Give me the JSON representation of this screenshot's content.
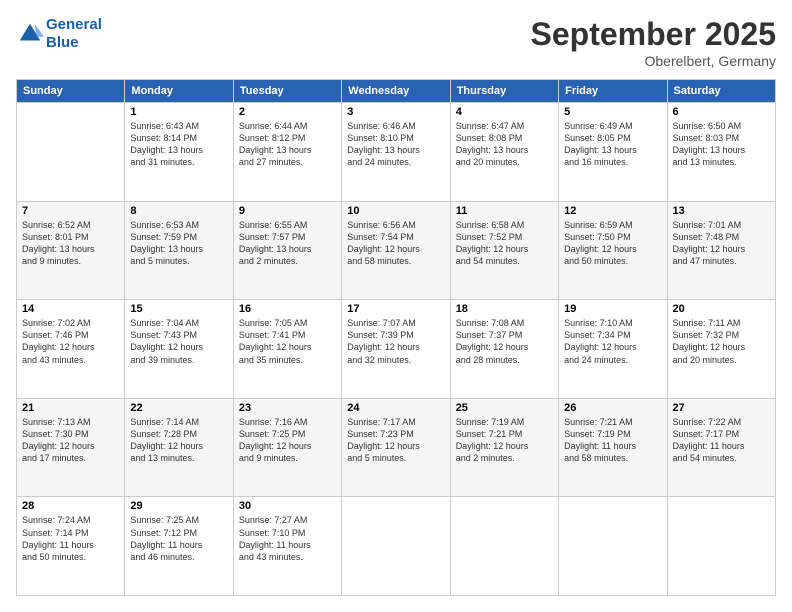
{
  "header": {
    "logo_line1": "General",
    "logo_line2": "Blue",
    "month": "September 2025",
    "location": "Oberelbert, Germany"
  },
  "days_of_week": [
    "Sunday",
    "Monday",
    "Tuesday",
    "Wednesday",
    "Thursday",
    "Friday",
    "Saturday"
  ],
  "weeks": [
    [
      {
        "day": "",
        "info": ""
      },
      {
        "day": "1",
        "info": "Sunrise: 6:43 AM\nSunset: 8:14 PM\nDaylight: 13 hours\nand 31 minutes."
      },
      {
        "day": "2",
        "info": "Sunrise: 6:44 AM\nSunset: 8:12 PM\nDaylight: 13 hours\nand 27 minutes."
      },
      {
        "day": "3",
        "info": "Sunrise: 6:46 AM\nSunset: 8:10 PM\nDaylight: 13 hours\nand 24 minutes."
      },
      {
        "day": "4",
        "info": "Sunrise: 6:47 AM\nSunset: 8:08 PM\nDaylight: 13 hours\nand 20 minutes."
      },
      {
        "day": "5",
        "info": "Sunrise: 6:49 AM\nSunset: 8:05 PM\nDaylight: 13 hours\nand 16 minutes."
      },
      {
        "day": "6",
        "info": "Sunrise: 6:50 AM\nSunset: 8:03 PM\nDaylight: 13 hours\nand 13 minutes."
      }
    ],
    [
      {
        "day": "7",
        "info": "Sunrise: 6:52 AM\nSunset: 8:01 PM\nDaylight: 13 hours\nand 9 minutes."
      },
      {
        "day": "8",
        "info": "Sunrise: 6:53 AM\nSunset: 7:59 PM\nDaylight: 13 hours\nand 5 minutes."
      },
      {
        "day": "9",
        "info": "Sunrise: 6:55 AM\nSunset: 7:57 PM\nDaylight: 13 hours\nand 2 minutes."
      },
      {
        "day": "10",
        "info": "Sunrise: 6:56 AM\nSunset: 7:54 PM\nDaylight: 12 hours\nand 58 minutes."
      },
      {
        "day": "11",
        "info": "Sunrise: 6:58 AM\nSunset: 7:52 PM\nDaylight: 12 hours\nand 54 minutes."
      },
      {
        "day": "12",
        "info": "Sunrise: 6:59 AM\nSunset: 7:50 PM\nDaylight: 12 hours\nand 50 minutes."
      },
      {
        "day": "13",
        "info": "Sunrise: 7:01 AM\nSunset: 7:48 PM\nDaylight: 12 hours\nand 47 minutes."
      }
    ],
    [
      {
        "day": "14",
        "info": "Sunrise: 7:02 AM\nSunset: 7:46 PM\nDaylight: 12 hours\nand 43 minutes."
      },
      {
        "day": "15",
        "info": "Sunrise: 7:04 AM\nSunset: 7:43 PM\nDaylight: 12 hours\nand 39 minutes."
      },
      {
        "day": "16",
        "info": "Sunrise: 7:05 AM\nSunset: 7:41 PM\nDaylight: 12 hours\nand 35 minutes."
      },
      {
        "day": "17",
        "info": "Sunrise: 7:07 AM\nSunset: 7:39 PM\nDaylight: 12 hours\nand 32 minutes."
      },
      {
        "day": "18",
        "info": "Sunrise: 7:08 AM\nSunset: 7:37 PM\nDaylight: 12 hours\nand 28 minutes."
      },
      {
        "day": "19",
        "info": "Sunrise: 7:10 AM\nSunset: 7:34 PM\nDaylight: 12 hours\nand 24 minutes."
      },
      {
        "day": "20",
        "info": "Sunrise: 7:11 AM\nSunset: 7:32 PM\nDaylight: 12 hours\nand 20 minutes."
      }
    ],
    [
      {
        "day": "21",
        "info": "Sunrise: 7:13 AM\nSunset: 7:30 PM\nDaylight: 12 hours\nand 17 minutes."
      },
      {
        "day": "22",
        "info": "Sunrise: 7:14 AM\nSunset: 7:28 PM\nDaylight: 12 hours\nand 13 minutes."
      },
      {
        "day": "23",
        "info": "Sunrise: 7:16 AM\nSunset: 7:25 PM\nDaylight: 12 hours\nand 9 minutes."
      },
      {
        "day": "24",
        "info": "Sunrise: 7:17 AM\nSunset: 7:23 PM\nDaylight: 12 hours\nand 5 minutes."
      },
      {
        "day": "25",
        "info": "Sunrise: 7:19 AM\nSunset: 7:21 PM\nDaylight: 12 hours\nand 2 minutes."
      },
      {
        "day": "26",
        "info": "Sunrise: 7:21 AM\nSunset: 7:19 PM\nDaylight: 11 hours\nand 58 minutes."
      },
      {
        "day": "27",
        "info": "Sunrise: 7:22 AM\nSunset: 7:17 PM\nDaylight: 11 hours\nand 54 minutes."
      }
    ],
    [
      {
        "day": "28",
        "info": "Sunrise: 7:24 AM\nSunset: 7:14 PM\nDaylight: 11 hours\nand 50 minutes."
      },
      {
        "day": "29",
        "info": "Sunrise: 7:25 AM\nSunset: 7:12 PM\nDaylight: 11 hours\nand 46 minutes."
      },
      {
        "day": "30",
        "info": "Sunrise: 7:27 AM\nSunset: 7:10 PM\nDaylight: 11 hours\nand 43 minutes."
      },
      {
        "day": "",
        "info": ""
      },
      {
        "day": "",
        "info": ""
      },
      {
        "day": "",
        "info": ""
      },
      {
        "day": "",
        "info": ""
      }
    ]
  ]
}
